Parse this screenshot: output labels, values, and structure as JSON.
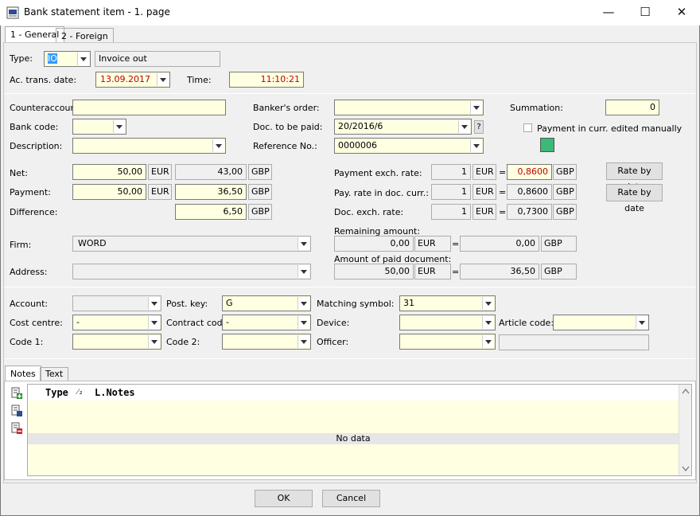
{
  "window": {
    "title": "Bank statement item - 1. page"
  },
  "tabs": [
    {
      "label": "1 - General"
    },
    {
      "label": "2 - Foreign"
    }
  ],
  "header": {
    "type_label": "Type:",
    "type_value": "IO",
    "type_desc": "Invoice out",
    "date_label": "Ac. trans. date:",
    "date_value": "13.09.2017",
    "time_label": "Time:",
    "time_value": "11:10:21"
  },
  "left": {
    "counteraccount_label": "Counteraccount:",
    "counteraccount_value": "",
    "bankcode_label": "Bank code:",
    "bankcode_value": "",
    "description_label": "Description:",
    "description_value": ""
  },
  "middle": {
    "bankers_order_label": "Banker's order:",
    "bankers_order_value": "",
    "doc_to_be_paid_label": "Doc. to be paid:",
    "doc_to_be_paid_value": "20/2016/6",
    "doc_q": "?",
    "reference_label": "Reference No.:",
    "reference_value": "0000006"
  },
  "right": {
    "summation_label": "Summation:",
    "summation_value": "0",
    "payment_manual_label": "Payment in curr. edited manually",
    "status_color": "#3cb878"
  },
  "amounts": {
    "net_label": "Net:",
    "net_value": "50,00",
    "net_cur": "EUR",
    "net_foreign": "43,00",
    "net_foreign_cur": "GBP",
    "payment_label": "Payment:",
    "payment_value": "50,00",
    "payment_cur": "EUR",
    "payment_foreign": "36,50",
    "payment_foreign_cur": "GBP",
    "difference_label": "Difference:",
    "difference_foreign": "6,50",
    "difference_foreign_cur": "GBP"
  },
  "rates": {
    "payment_exch_label": "Payment exch. rate:",
    "payment_exch_amount": "1",
    "payment_exch_cur": "EUR",
    "payment_exch_rate": "0,8600",
    "payment_exch_rate_cur": "GBP",
    "pay_rate_doc_label": "Pay. rate in doc. curr.:",
    "pay_rate_doc_amount": "1",
    "pay_rate_doc_cur": "EUR",
    "pay_rate_doc_rate": "0,8600",
    "pay_rate_doc_rate_cur": "GBP",
    "doc_exch_label": "Doc. exch. rate:",
    "doc_exch_amount": "1",
    "doc_exch_cur": "EUR",
    "doc_exch_rate": "0,7300",
    "doc_exch_rate_cur": "GBP",
    "rate_by_date_1": "Rate by date",
    "rate_by_date_2": "Rate by date",
    "eq": "="
  },
  "firm": {
    "firm_label": "Firm:",
    "firm_value": "WORD",
    "address_label": "Address:",
    "address_value": "",
    "remaining_label": "Remaining amount:",
    "remaining_value": "0,00",
    "remaining_cur": "EUR",
    "remaining_foreign": "0,00",
    "remaining_foreign_cur": "GBP",
    "paid_doc_label": "Amount of paid document:",
    "paid_doc_value": "50,00",
    "paid_doc_cur": "EUR",
    "paid_doc_foreign": "36,50",
    "paid_doc_foreign_cur": "GBP"
  },
  "accounting": {
    "account_label": "Account:",
    "account_value": "",
    "postkey_label": "Post. key:",
    "postkey_value": "G",
    "matching_label": "Matching symbol:",
    "matching_value": "31",
    "costcentre_label": "Cost centre:",
    "costcentre_value": "-",
    "contract_label": "Contract code:",
    "contract_value": "-",
    "device_label": "Device:",
    "device_value": "",
    "article_label": "Article code:",
    "article_value": "",
    "code1_label": "Code 1:",
    "code1_value": "",
    "code2_label": "Code 2:",
    "code2_value": "",
    "officer_label": "Officer:",
    "officer_value": "",
    "officer_name": ""
  },
  "notes": {
    "tabs": [
      {
        "label": "Notes"
      },
      {
        "label": "Text"
      }
    ],
    "col_type": "Type",
    "col_sort": "⁄₂",
    "col_notes": "L.Notes",
    "empty": "No data"
  },
  "footer": {
    "ok": "OK",
    "cancel": "Cancel"
  }
}
